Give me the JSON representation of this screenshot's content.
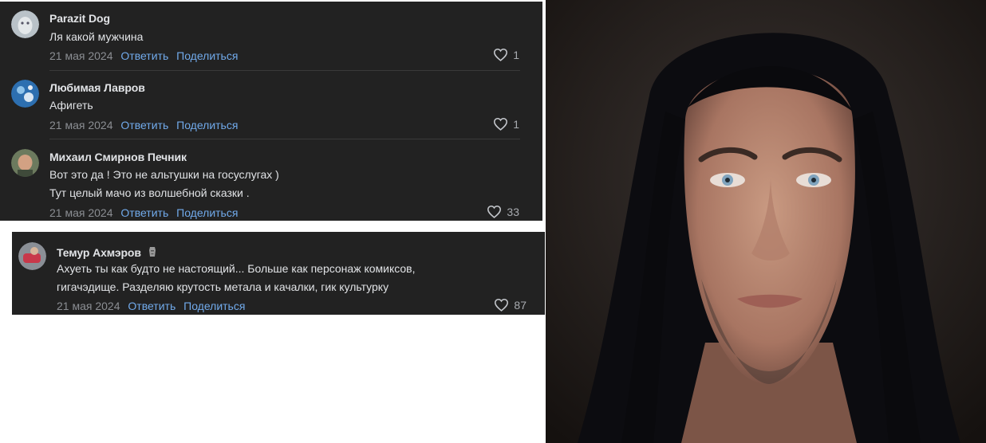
{
  "comments": [
    {
      "author": "Parazit Dog",
      "lines": [
        "Ля какой мужчина"
      ],
      "date": "21 мая 2024",
      "reply": "Ответить",
      "share": "Поделиться",
      "likes": "1"
    },
    {
      "author": "Любимая Лавров",
      "lines": [
        "Афигеть"
      ],
      "date": "21 мая 2024",
      "reply": "Ответить",
      "share": "Поделиться",
      "likes": "1"
    },
    {
      "author": "Михаил Смирнов Печник",
      "lines": [
        "Вот это да ! Это не альтушки на госуслугах )",
        "Тут целый мачо из волшебной сказки ."
      ],
      "date": "21 мая 2024",
      "reply": "Ответить",
      "share": "Поделиться",
      "likes": "33"
    },
    {
      "author": "Темур Ахмэров",
      "lines": [
        "Ахуеть ты как будто не настоящий... Больше как персонаж комиксов,",
        "гигачэдище. Разделяю крутость метала и качалки, гик культурку"
      ],
      "date": "21 мая 2024",
      "reply": "Ответить",
      "share": "Поделиться",
      "likes": "87"
    }
  ],
  "colors": {
    "panel_bg": "#222222",
    "text": "#e1e3e6",
    "muted": "#8b8e93",
    "link": "#71aaeb"
  }
}
